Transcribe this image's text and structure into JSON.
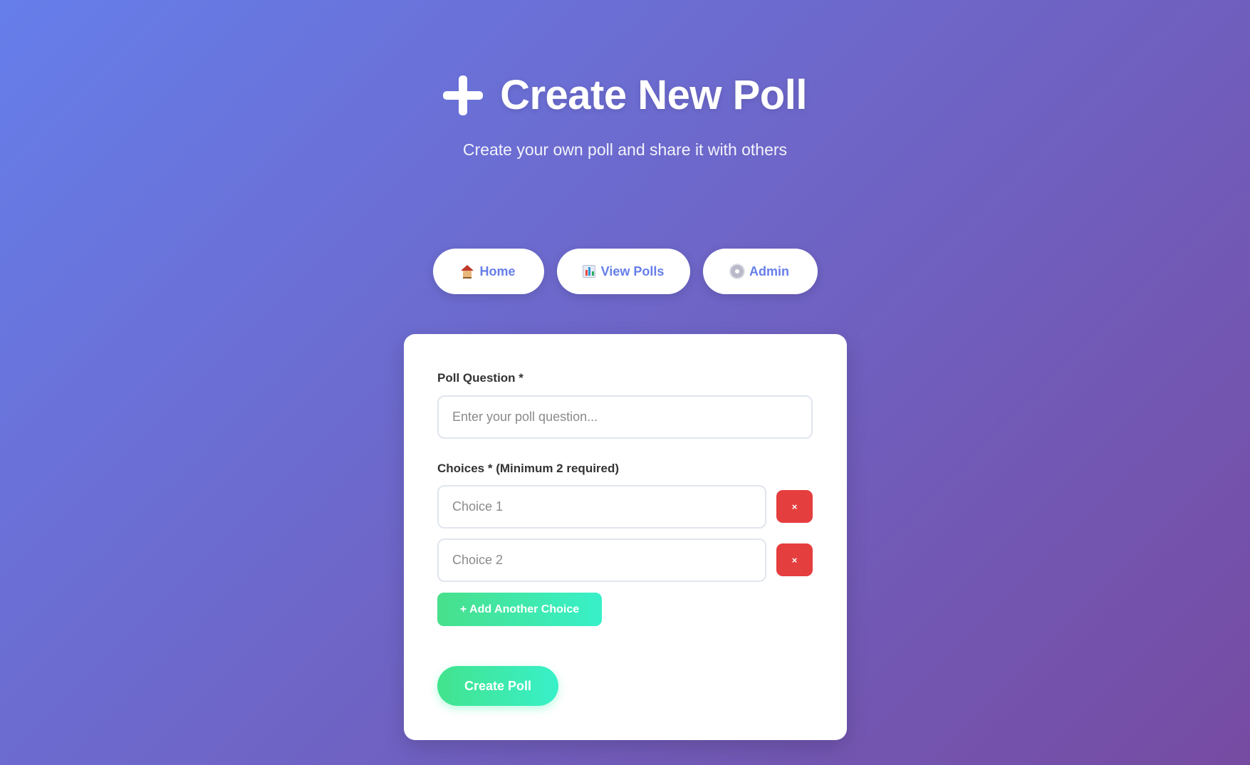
{
  "header": {
    "title": "Create New Poll",
    "title_icon": "plus-icon",
    "subtitle": "Create your own poll and share it with others"
  },
  "nav": {
    "items": [
      {
        "label": "Home",
        "icon": "house-icon"
      },
      {
        "label": "View Polls",
        "icon": "bar-chart-icon"
      },
      {
        "label": "Admin",
        "icon": "gear-icon"
      }
    ]
  },
  "form": {
    "question_label": "Poll Question *",
    "question_placeholder": "Enter your poll question...",
    "question_value": "",
    "choices_label": "Choices * (Minimum 2 required)",
    "choices": [
      {
        "placeholder": "Choice 1",
        "value": "",
        "remove_label": "×"
      },
      {
        "placeholder": "Choice 2",
        "value": "",
        "remove_label": "×"
      }
    ],
    "add_choice_label": "+ Add Another Choice",
    "submit_label": "Create Poll"
  },
  "colors": {
    "background_start": "#667eea",
    "background_end": "#764ba2",
    "nav_text": "#667eea",
    "remove_button": "#e53e3e",
    "success_gradient_start": "#43e38d",
    "success_gradient_end": "#38f0c9"
  }
}
